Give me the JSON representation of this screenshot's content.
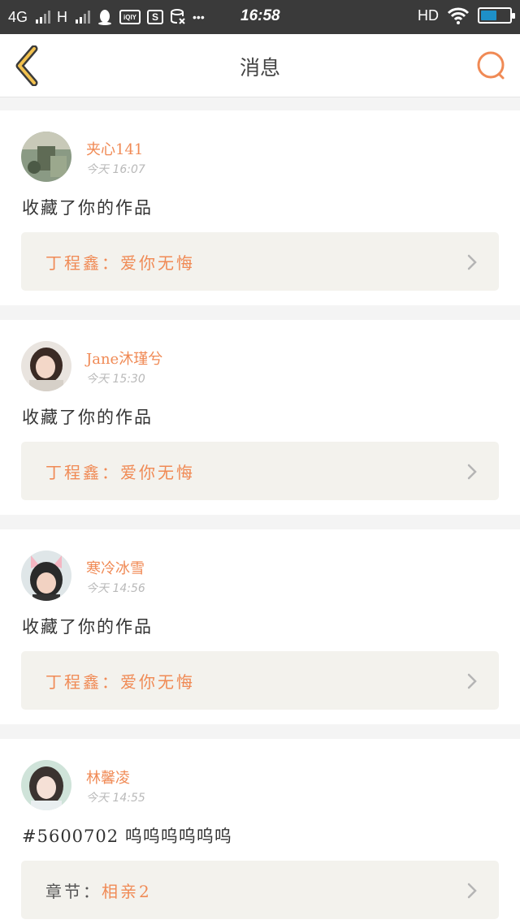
{
  "status_bar": {
    "network": "4G",
    "network2": "H",
    "app_icon_iqiyi": "iQIY",
    "app_icon_s": "S",
    "dots": "•••",
    "time": "16:58",
    "hd": "HD",
    "battery_level": 0.6,
    "icons": [
      "qq-penguin-icon",
      "iqiyi-icon",
      "s-app-icon",
      "storage-icon",
      "wifi-icon",
      "battery-icon"
    ]
  },
  "header": {
    "title": "消息",
    "back_icon": "chevron-left-icon",
    "search_icon": "search-icon",
    "accent_color": "#f08a55"
  },
  "messages": [
    {
      "username": "夹心141",
      "time": "今天 16:07",
      "action": "收藏了你的作品",
      "work_prefix": "丁程鑫：",
      "work_title": "爱你无悔"
    },
    {
      "username": "Jane沐瑾兮",
      "time": "今天 15:30",
      "action": "收藏了你的作品",
      "work_prefix": "丁程鑫：",
      "work_title": "爱你无悔"
    },
    {
      "username": "寒冷冰雪",
      "time": "今天 14:56",
      "action": "收藏了你的作品",
      "work_prefix": "丁程鑫：",
      "work_title": "爱你无悔"
    },
    {
      "username": "林馨凌",
      "time": "今天 14:55",
      "action": "#5600702 呜呜呜呜呜呜",
      "work_prefix": "章节：",
      "work_title": "相亲2"
    }
  ]
}
